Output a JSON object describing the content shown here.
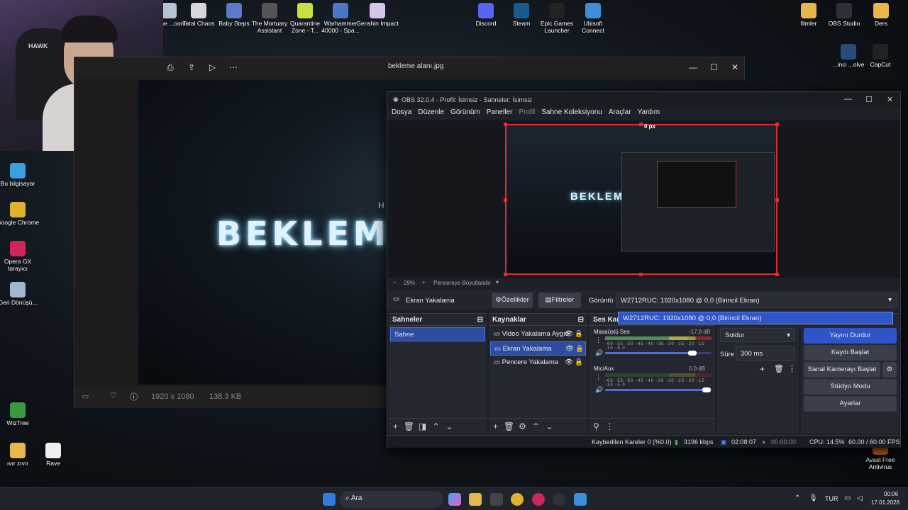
{
  "desktop": {
    "top_icons": [
      {
        "label": "...e the ...ooms",
        "color": "#b4c4d0"
      },
      {
        "label": "Total Chaos",
        "color": "#d7d7d7"
      },
      {
        "label": "Baby Steps",
        "color": "#5a7cc6"
      },
      {
        "label": "The Mortuary Assistant",
        "color": "#555"
      },
      {
        "label": "Quarantine Zone - T...",
        "color": "#c9e040"
      },
      {
        "label": "Warhammer 40000 - Spa...",
        "color": "#4a78c6"
      },
      {
        "label": "Genshin Impact",
        "color": "#d3c6e6"
      },
      {
        "label": "Discord",
        "color": "#5865f2"
      },
      {
        "label": "Steam",
        "color": "#1b5a8c"
      },
      {
        "label": "Epic Games Launcher",
        "color": "#222"
      },
      {
        "label": "Ubisoft Connect",
        "color": "#3a8fd8"
      },
      {
        "label": "filmler",
        "color": "#e8b74a"
      },
      {
        "label": "OBS Studio",
        "color": "#303038"
      },
      {
        "label": "Ders",
        "color": "#e8b74a"
      }
    ],
    "left_icons": [
      {
        "label": "Bu bilgisayar",
        "color": "#3aa0e0"
      },
      {
        "label": "Google Chrome",
        "color": "#e0b030"
      },
      {
        "label": "Opera GX tarayıcı",
        "color": "#d0245a"
      },
      {
        "label": "Geri Dönüşü...",
        "color": "#9fb8d0"
      },
      {
        "label": "WizTree",
        "color": "#3a9a40"
      },
      {
        "label": "ıvır zıvır",
        "color": "#e8b74a"
      }
    ],
    "right_icons": [
      {
        "label": "...inci ...olve",
        "color": "#2a4a7a"
      },
      {
        "label": "CapCut",
        "color": "#222"
      },
      {
        "label": "Avast Free Antivirus",
        "color": "#f07020"
      }
    ],
    "rave_label": "Rave",
    "cam_logo": "HAWK"
  },
  "viewer": {
    "title": "bekleme alanı.jpg",
    "image_text": "BEKLEM",
    "resolution": "1920 x 1080",
    "size": "138.3 KB",
    "cursor_glyph": "H"
  },
  "obs": {
    "title": "OBS 32.0.4 - Profil: İsimsiz - Sahneler: İsimsiz",
    "menu": [
      "Dosya",
      "Düzenle",
      "Görünüm",
      "Paneller",
      "Profil",
      "Sahne Koleksiyonu",
      "Araçlar",
      "Yardım"
    ],
    "preview": {
      "offset_label": "0 px",
      "zoom": "29%",
      "fit_label": "Pencereye Boyutlandır",
      "image_text": "BEKLEM"
    },
    "source_bar": {
      "name": "Ekran Yakalama",
      "properties": "Özellikler",
      "filters": "Filtreler",
      "display_label": "Görüntü",
      "display_value": "W2712RUC: 1920x1080 @ 0,0 (Birincil Ekran)",
      "dropdown_option": "W2712RUC: 1920x1080 @ 0,0 (Birincil Ekran)"
    },
    "scenes": {
      "title": "Sahneler",
      "items": [
        "Sahne"
      ]
    },
    "sources": {
      "title": "Kaynaklar",
      "items": [
        "Video Yakalama Aygıtı",
        "Ekran Yakalama",
        "Pencere Yakalama"
      ]
    },
    "mixer": {
      "title": "Ses Karıştırıcı",
      "channels": [
        {
          "name": "Masaüstü Ses",
          "db": "-17.9 dB",
          "level": 0.78,
          "volume": 0.82
        },
        {
          "name": "Mic/Aux",
          "db": "0.0 dB",
          "level": 0.0,
          "volume": 0.95
        }
      ],
      "scale": "-60 -55 -50 -45 -40 -35 -30 -25 -20 -15 -10 -5 0"
    },
    "transitions": {
      "type": "Soldur",
      "duration_label": "Süre",
      "duration": "300 ms"
    },
    "controls": {
      "stream": "Yayını Durdur",
      "record": "Kaydı Başlat",
      "virtualcam": "Sanal Kamerayı Başlat",
      "studio": "Stüdyo Modu",
      "settings": "Ayarlar"
    },
    "status": {
      "dropped": "Kaybedilen Kareler 0 (%0.0)",
      "bitrate": "3196 kbps",
      "stream_time": "02:08:07",
      "rec_time": "00:00:00",
      "cpu": "CPU: 14.5%",
      "fps": "60.00 / 60.00 FPS"
    }
  },
  "taskbar": {
    "search": "Ara",
    "lang": "TUR",
    "time": "00:06",
    "date": "17.01.2026"
  },
  "colors": {
    "accent": "#2f4d9e",
    "selection": "#e32d2d",
    "button_active": "#2f55c8"
  }
}
